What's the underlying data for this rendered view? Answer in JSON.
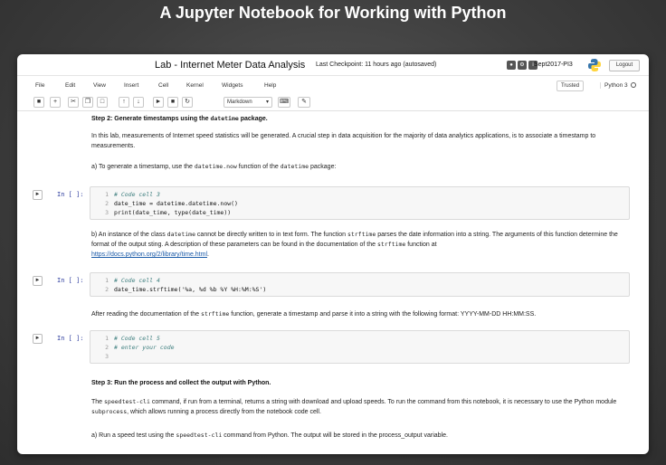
{
  "slide_title": "A Jupyter Notebook for Working with Python",
  "header": {
    "notebook_title": "Lab - Internet Meter Data Analysis",
    "checkpoint": "Last Checkpoint: 11 hours ago (autosaved)",
    "kernel_label": "Sept2017-PI3",
    "logout_label": "Logout"
  },
  "menubar": {
    "items": [
      "File",
      "Edit",
      "View",
      "Insert",
      "Cell",
      "Kernel",
      "Widgets",
      "Help"
    ],
    "trusted": "Trusted",
    "kernel": "Python 3"
  },
  "toolbar": {
    "cell_type": "Markdown"
  },
  "cells": {
    "step2_heading_a": "Step 2: Generate timestamps using the ",
    "step2_heading_code": "datetime",
    "step2_heading_b": " package.",
    "step2_intro": "In this lab, measurements of Internet speed statistics will be generated. A crucial step in data acquisition for the majority of data analytics applications, is to associate a timestamp to measurements.",
    "step2a_pre": "a) To generate a timestamp, use the ",
    "step2a_code1": "datetime.now",
    "step2a_mid": " function of the ",
    "step2a_code2": "datetime",
    "step2a_post": " package:",
    "prompt": "In [ ]:",
    "code3": [
      {
        "n": "1",
        "text": "# Code cell 3"
      },
      {
        "n": "2",
        "text": "date_time = datetime.datetime.now()"
      },
      {
        "n": "3",
        "text": "print(date_time, type(date_time))"
      }
    ],
    "step2b_1": "b) An instance of the class ",
    "step2b_code1": "datetime",
    "step2b_2": " cannot be directly written to in text form. The function ",
    "step2b_code2": "strftime",
    "step2b_3": " parses the date information into a string. The arguments of this function determine the format of the output sting. A description of these parameters can be found in the documentation of the ",
    "step2b_code3": "strftime",
    "step2b_4": " function at",
    "step2b_link": "https://docs.python.org/2/library/time.html",
    "step2b_dot": ".",
    "code4": [
      {
        "n": "1",
        "text": "# Code cell 4"
      },
      {
        "n": "2",
        "text": "date_time.strftime('%a, %d %b %Y %H:%M:%S')"
      }
    ],
    "after_1": "After reading the documentation of the ",
    "after_code": "strftime",
    "after_2": " function, generate a timestamp and parse it into a string with the following format: YYYY-MM-DD HH:MM:SS.",
    "code5": [
      {
        "n": "1",
        "text": "# Code cell 5"
      },
      {
        "n": "2",
        "text": "# enter your code"
      },
      {
        "n": "3",
        "text": ""
      }
    ],
    "step3_heading": "Step 3: Run the process and collect the output with Python.",
    "step3_code1": "speedtest-cli",
    "step3_1a": "The ",
    "step3_1b": " command, if run from a terminal, returns a string with download and upload speeds. To run the command from this notebook, it is necessary to use the Python module ",
    "step3_code2": "subprocess",
    "step3_1c": ", which allows running a process directly from the notebook code cell.",
    "step3a_1": "a) Run a speed test using the ",
    "step3a_code": "speedtest-cli",
    "step3a_2": " command from Python. The output will be stored in the process_output variable."
  },
  "colors": {
    "accent": "#303f9f",
    "link": "#1a5aa8",
    "comment": "#408080",
    "string": "#ba2121"
  }
}
